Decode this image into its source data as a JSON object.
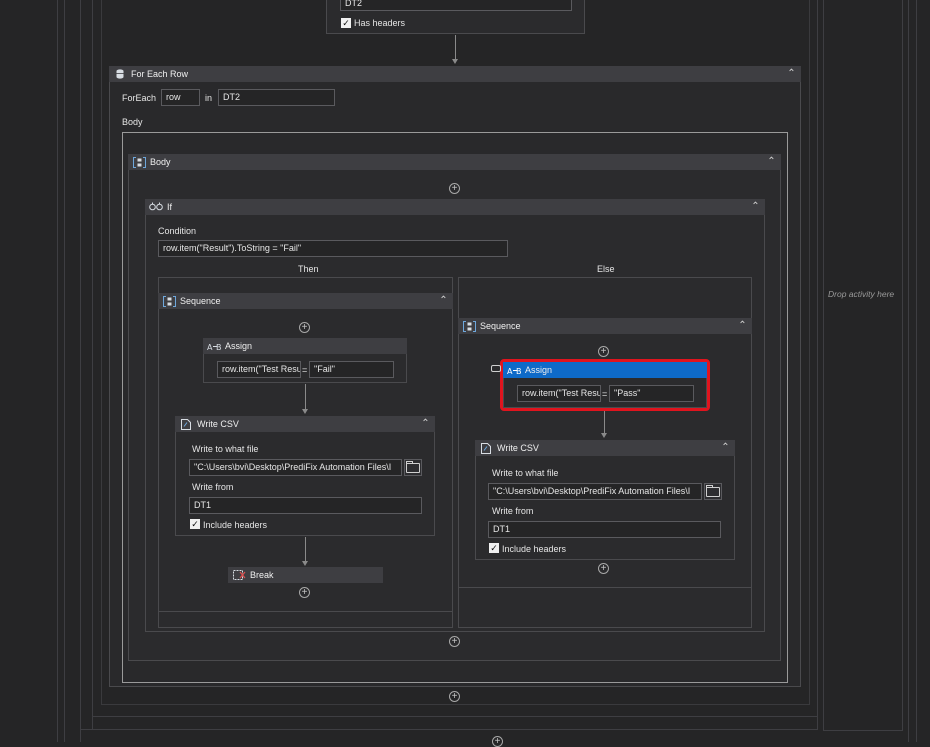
{
  "top_activity": {
    "table_value": "DT2",
    "has_headers_label": "Has headers",
    "has_headers_checked": "✓"
  },
  "for_each_row": {
    "title": "For Each Row",
    "foreach_label": "ForEach",
    "item_variable": "row",
    "in_label": "in",
    "collection": "DT2",
    "body_label": "Body"
  },
  "body_sequence": {
    "title": "Body"
  },
  "if_activity": {
    "title": "If",
    "condition_label": "Condition",
    "condition_value": "row.item(\"Result\").ToString = \"Fail\"",
    "then_label": "Then",
    "else_label": "Else"
  },
  "then_branch": {
    "sequence_title": "Sequence",
    "assign": {
      "title": "Assign",
      "target": "row.item(\"Test Resu",
      "equals": "=",
      "value": "\"Fail\""
    },
    "write_csv": {
      "title": "Write CSV",
      "file_label": "Write to what file",
      "file_value": "\"C:\\Users\\bvi\\Desktop\\PrediFix Automation Files\\I",
      "from_label": "Write from",
      "from_value": "DT1",
      "include_headers_label": "Include headers",
      "include_headers_checked": "✓"
    },
    "break": {
      "title": "Break"
    }
  },
  "else_branch": {
    "sequence_title": "Sequence",
    "assign": {
      "title": "Assign",
      "target": "row.item(\"Test Resu",
      "equals": "=",
      "value": "\"Pass\""
    },
    "write_csv": {
      "title": "Write CSV",
      "file_label": "Write to what file",
      "file_value": "\"C:\\Users\\bvi\\Desktop\\PrediFix Automation Files\\I",
      "from_label": "Write from",
      "from_value": "DT1",
      "include_headers_label": "Include headers",
      "include_headers_checked": "✓"
    }
  },
  "drop_zone": {
    "label": "Drop activity here"
  },
  "icons": {
    "collapse": "⌃",
    "add": "+",
    "datatable": "database-icon",
    "sequence": "sequence-icon",
    "if": "if-icon",
    "assign": "assign-icon",
    "write_csv": "csv-file-icon",
    "break": "break-icon"
  },
  "colors": {
    "selection_border": "#e0141e",
    "selected_header": "#0e6ac8",
    "canvas": "#252526"
  }
}
